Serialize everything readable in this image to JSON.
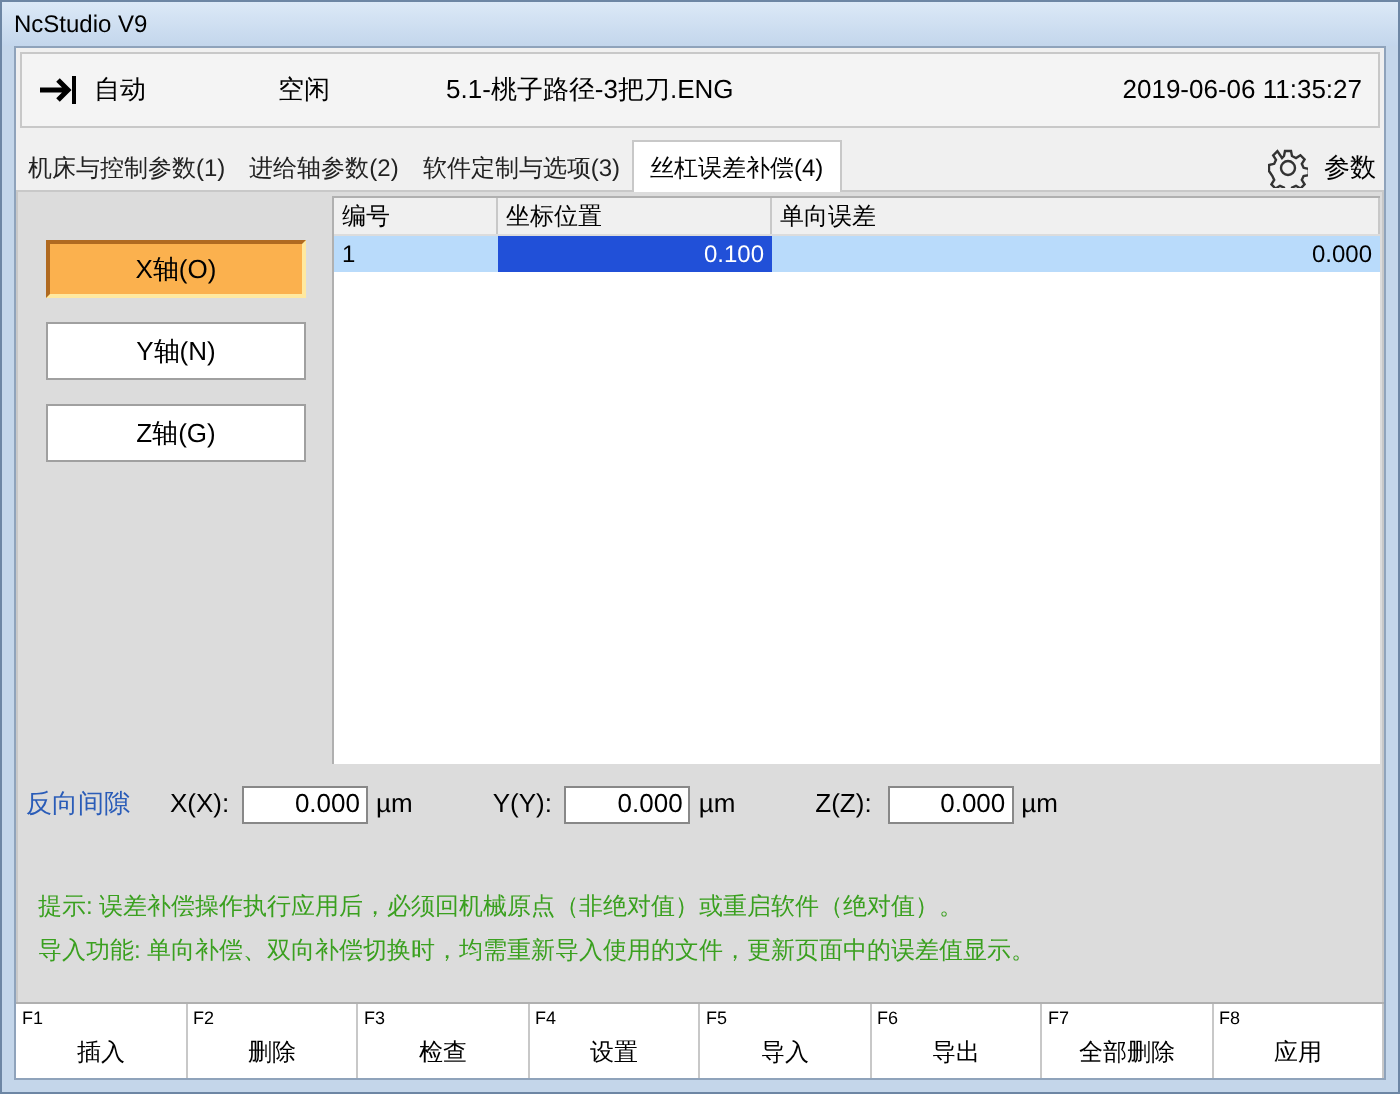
{
  "window": {
    "title": "NcStudio V9"
  },
  "status": {
    "mode": "自动",
    "state": "空闲",
    "file": "5.1-桃子路径-3把刀.ENG",
    "datetime": "2019-06-06 11:35:27"
  },
  "tabs": [
    {
      "label": "机床与控制参数(1)",
      "selected": false
    },
    {
      "label": "进给轴参数(2)",
      "selected": false
    },
    {
      "label": "软件定制与选项(3)",
      "selected": false
    },
    {
      "label": "丝杠误差补偿(4)",
      "selected": true
    }
  ],
  "params_button": "参数",
  "axes": [
    {
      "label": "X轴(O)",
      "selected": true
    },
    {
      "label": "Y轴(N)",
      "selected": false
    },
    {
      "label": "Z轴(G)",
      "selected": false
    }
  ],
  "table": {
    "columns": [
      "编号",
      "坐标位置",
      "单向误差"
    ],
    "rows": [
      {
        "cells": [
          "1",
          "0.100",
          "0.000"
        ],
        "selected": true
      }
    ]
  },
  "backlash": {
    "label": "反向间隙",
    "fields": [
      {
        "label": "X(X):",
        "value": "0.000",
        "unit": "µm"
      },
      {
        "label": "Y(Y):",
        "value": "0.000",
        "unit": "µm"
      },
      {
        "label": "Z(Z):",
        "value": "0.000",
        "unit": "µm"
      }
    ]
  },
  "notes": [
    "提示: 误差补偿操作执行应用后，必须回机械原点（非绝对值）或重启软件（绝对值）。",
    "导入功能: 单向补偿、双向补偿切换时，均需重新导入使用的文件，更新页面中的误差值显示。"
  ],
  "function_keys": [
    {
      "key": "F1",
      "label": "插入"
    },
    {
      "key": "F2",
      "label": "删除"
    },
    {
      "key": "F3",
      "label": "检查"
    },
    {
      "key": "F4",
      "label": "设置"
    },
    {
      "key": "F5",
      "label": "导入"
    },
    {
      "key": "F6",
      "label": "导出"
    },
    {
      "key": "F7",
      "label": "全部删除"
    },
    {
      "key": "F8",
      "label": "应用"
    }
  ]
}
